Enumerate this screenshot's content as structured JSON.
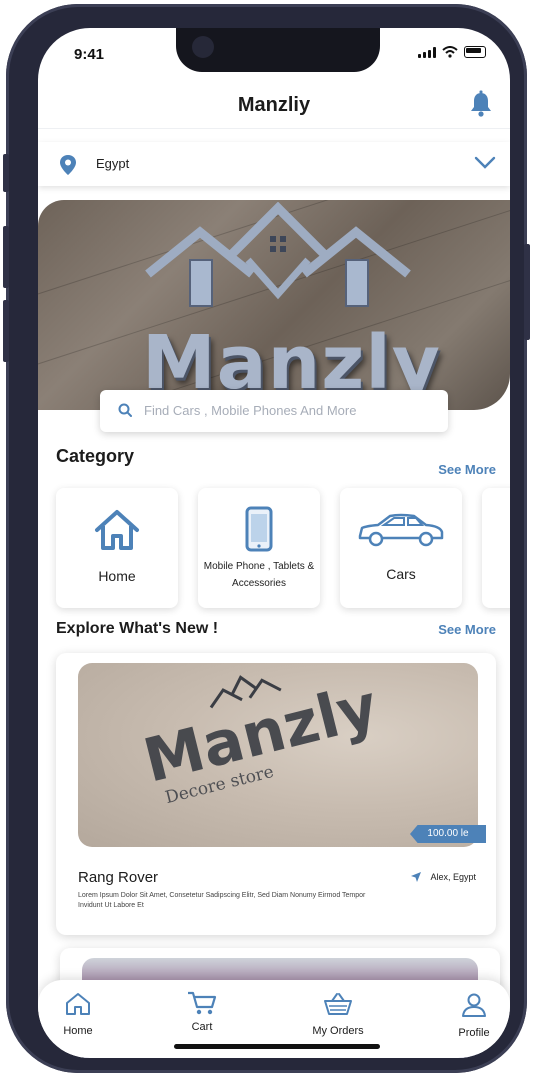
{
  "status": {
    "time": "9:41"
  },
  "header": {
    "title": "Manzliy"
  },
  "location": {
    "value": "Egypt"
  },
  "banner": {
    "brand": "Manzly"
  },
  "search": {
    "placeholder": "Find Cars , Mobile Phones And More"
  },
  "category": {
    "title": "Category",
    "see_more": "See More",
    "items": [
      {
        "label": "Home",
        "icon": "house-icon"
      },
      {
        "label": "Mobile Phone , Tablets & Accessories",
        "icon": "smartphone-icon"
      },
      {
        "label": "Cars",
        "icon": "car-icon"
      }
    ]
  },
  "explore": {
    "title": "Explore What's New !",
    "see_more": "See More",
    "products": [
      {
        "brand": "Manzly",
        "brand_sub": "Decore store",
        "price": "100.00 le",
        "name": "Rang Rover",
        "location": "Alex, Egypt",
        "description": "Lorem Ipsum Dolor Sit Amet, Consetetur Sadipscing Elitr, Sed Diam Nonumy Eirmod Tempor Invidunt Ut Labore Et"
      }
    ]
  },
  "tabs": [
    {
      "label": "Home",
      "icon": "home-icon"
    },
    {
      "label": "Cart",
      "icon": "cart-icon"
    },
    {
      "label": "My Orders",
      "icon": "basket-icon"
    },
    {
      "label": "Profile",
      "icon": "user-icon"
    }
  ],
  "colors": {
    "accent": "#4d82b8",
    "frame": "#26283a"
  }
}
